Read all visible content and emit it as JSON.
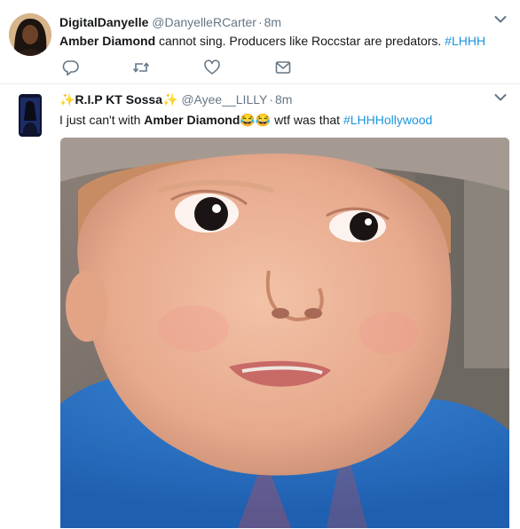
{
  "tweets": [
    {
      "display_name": "DigitalDanyelle",
      "handle": "@DanyelleRCarter",
      "separator": "·",
      "time": "8m",
      "text_bold": "Amber Diamond",
      "text_rest": " cannot sing. Producers like Roccstar are predators. ",
      "hashtag": "#LHHH"
    },
    {
      "display_name_prefix": "✨",
      "display_name": "R.I.P KT Sossa",
      "display_name_suffix": "✨",
      "handle": "@Ayee__LILLY",
      "separator": "·",
      "time": "8m",
      "text_pre": "I just can't with ",
      "text_bold": "Amber Diamond",
      "emoji": "😂😂",
      "text_post": " wtf was that ",
      "hashtag": "#LHHHollywood"
    }
  ],
  "icons": [
    "reply-icon",
    "retweet-icon",
    "like-icon",
    "message-icon",
    "chevron-down-icon"
  ],
  "colors": {
    "link": "#1b95e0",
    "secondary": "#657786",
    "icon": "#657786",
    "divider": "#e6ecf0"
  }
}
